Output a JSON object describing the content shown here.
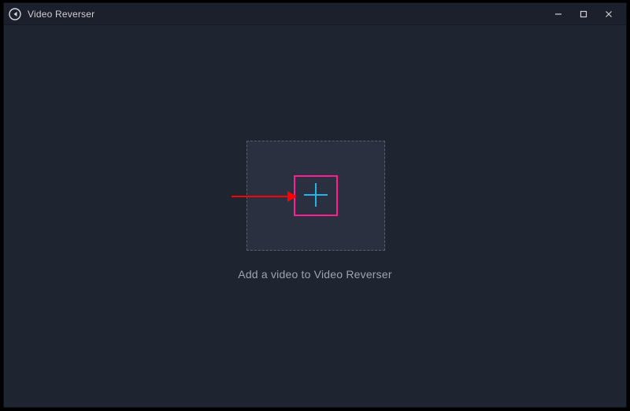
{
  "window": {
    "title": "Video Reverser",
    "app_icon_name": "reverse-icon"
  },
  "main": {
    "caption": "Add a video to Video Reverser"
  },
  "colors": {
    "background": "#1f2431",
    "panel": "#2b3040",
    "titlebar": "#1b202c",
    "text_muted": "#9fa3ac",
    "plus": "#24b4e6",
    "highlight": "#ff1e91",
    "arrow": "#ff0000"
  }
}
